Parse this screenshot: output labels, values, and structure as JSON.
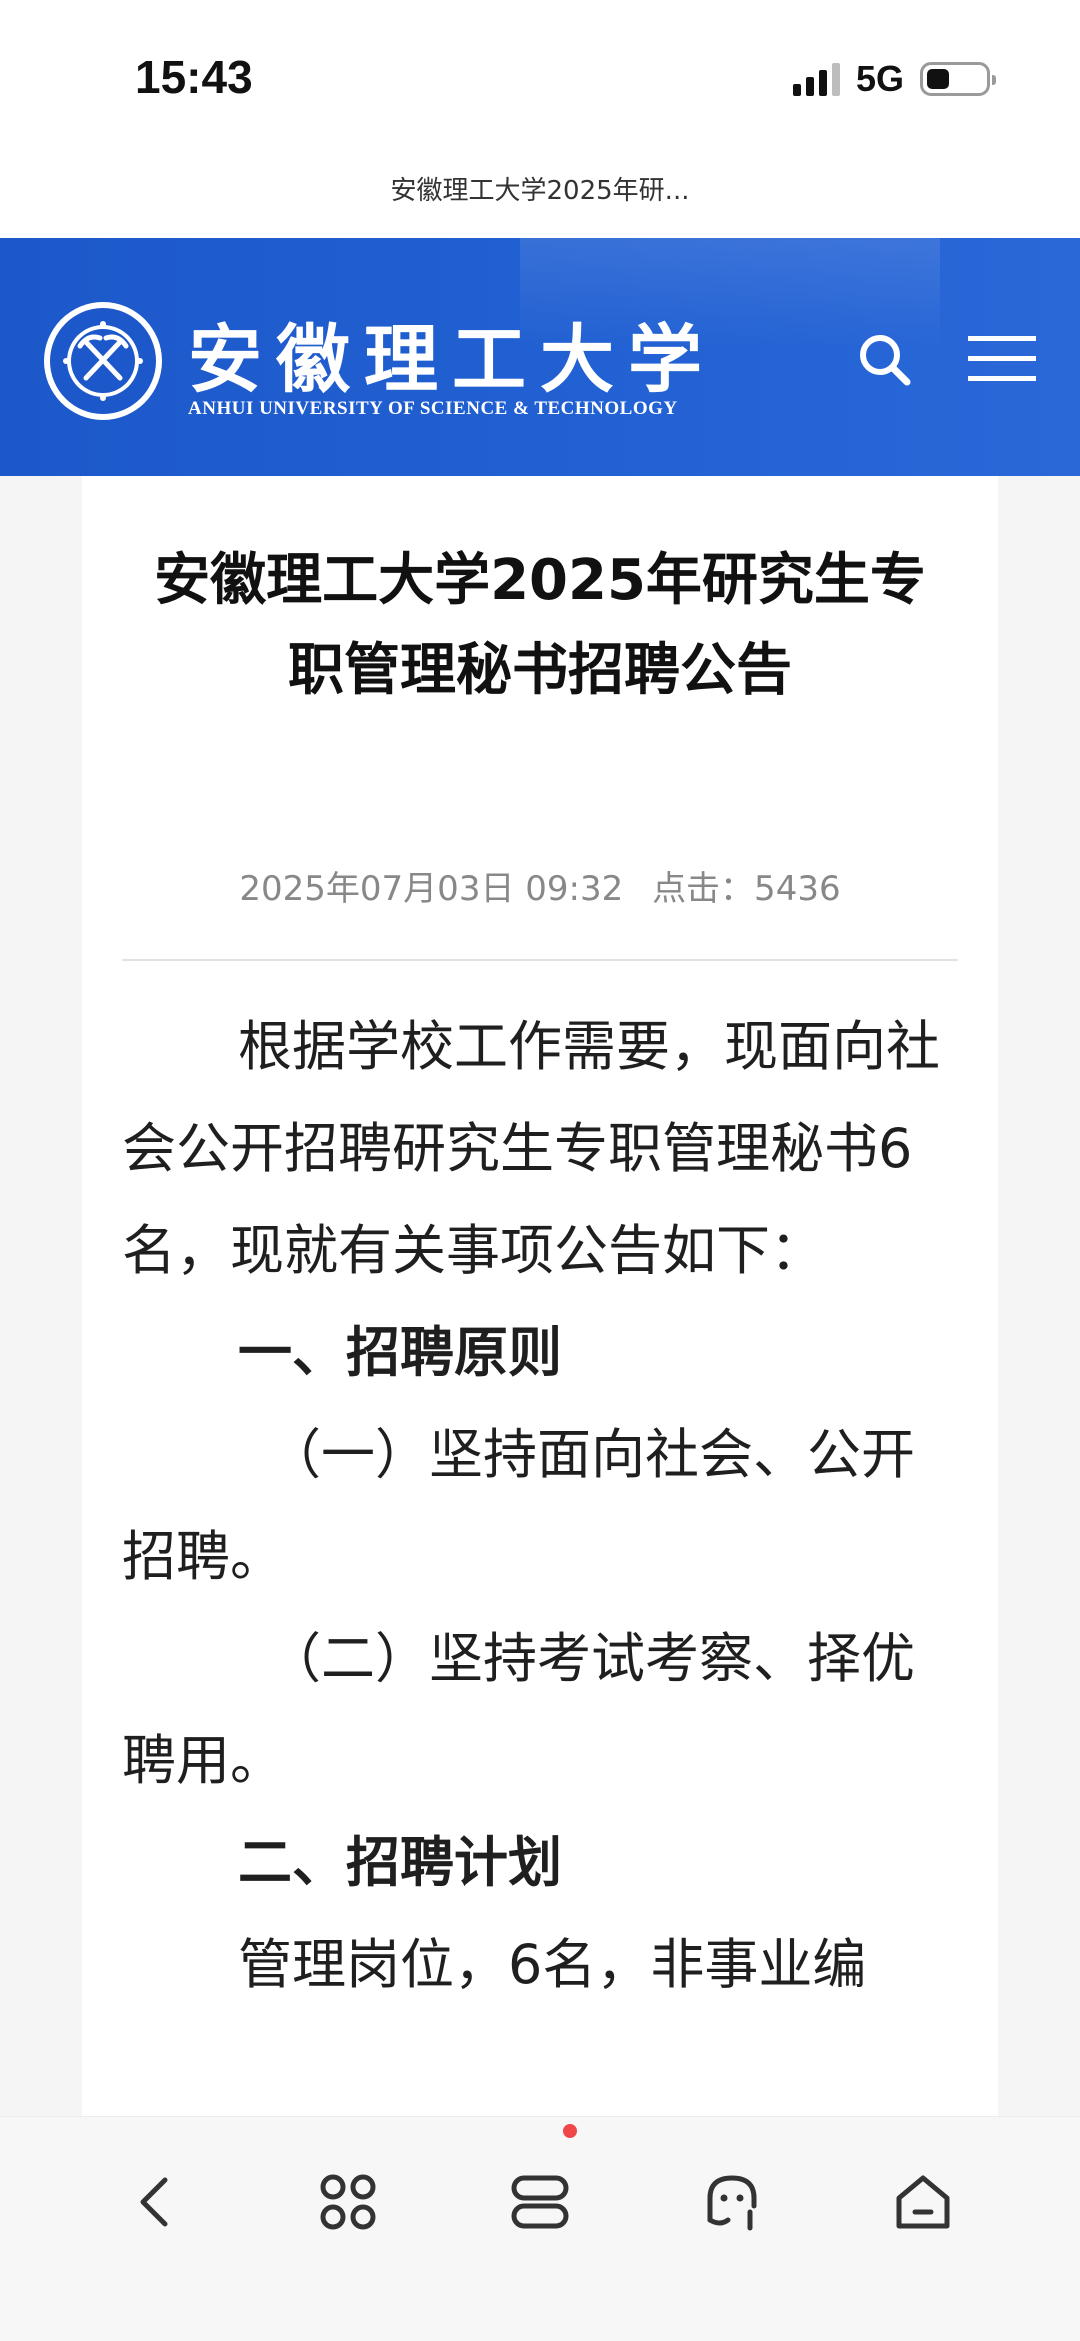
{
  "status_bar": {
    "time": "15:43",
    "network": "5G"
  },
  "browser": {
    "page_title": "安徽理工大学2025年研..."
  },
  "site": {
    "name_cn": "安徽理工大学",
    "name_en": "ANHUI UNIVERSITY OF SCIENCE & TECHNOLOGY",
    "brand_color": "#2261d3"
  },
  "article": {
    "title_line1": "安徽理工大学2025年研究生专",
    "title_line2": "职管理秘书招聘公告",
    "date": "2025年07月03日 09:32",
    "clicks": "点击：5436",
    "paragraphs": {
      "intro": "根据学校工作需要，现面向社会公开招聘研究生专职管理秘书6名，现就有关事项公告如下：",
      "section1_heading": "一、招聘原则",
      "principle1": "（一）坚持面向社会、公开招聘。",
      "principle2": "（二）坚持考试考察、择优聘用。",
      "section2_heading": "二、招聘计划",
      "plan": "管理岗位，6名，非事业编"
    }
  },
  "bottom_nav": {
    "items": [
      "back-icon",
      "apps-icon",
      "tabs-icon",
      "assistant-icon",
      "home-icon"
    ],
    "notification_color": "#f0474b"
  }
}
